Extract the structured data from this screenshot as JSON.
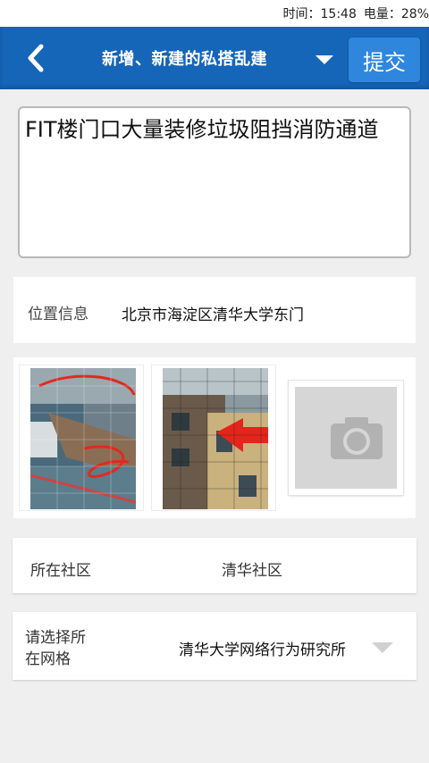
{
  "status": {
    "time": "时间：15:48",
    "battery": "电量：28%"
  },
  "header": {
    "title": "新增、新建的私搭乱建",
    "submit_label": "提交"
  },
  "description": {
    "text": "FIT楼门口大量装修垃圾阻挡消防通道"
  },
  "location": {
    "label": "位置信息",
    "value": "北京市海淀区清华大学东门"
  },
  "photos": {
    "items": [
      "photo-1",
      "photo-2"
    ],
    "add_icon": "camera-icon"
  },
  "community": {
    "label": "所在社区",
    "value": "清华社区"
  },
  "grid": {
    "label_line1": "请选择所",
    "label_line2": "在网格",
    "value": "清华大学网络行为研究所"
  },
  "colors": {
    "appbar": "#1565b8",
    "submit": "#2f86dd",
    "background": "#efefef"
  }
}
